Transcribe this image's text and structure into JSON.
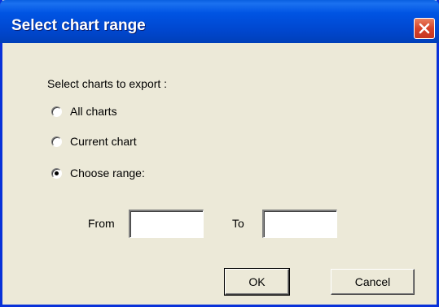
{
  "window": {
    "title": "Select chart range"
  },
  "section_label": "Select charts to export :",
  "options": [
    {
      "label": "All charts",
      "checked": false
    },
    {
      "label": "Current chart",
      "checked": false
    },
    {
      "label": "Choose range:",
      "checked": true
    }
  ],
  "range": {
    "from_label": "From",
    "from_value": "",
    "to_label": "To",
    "to_value": ""
  },
  "buttons": {
    "ok_label": "OK",
    "cancel_label": "Cancel"
  },
  "colors": {
    "titlebar": "#0054e3",
    "window_bg": "#ece9d8",
    "close_button": "#d6432a"
  }
}
